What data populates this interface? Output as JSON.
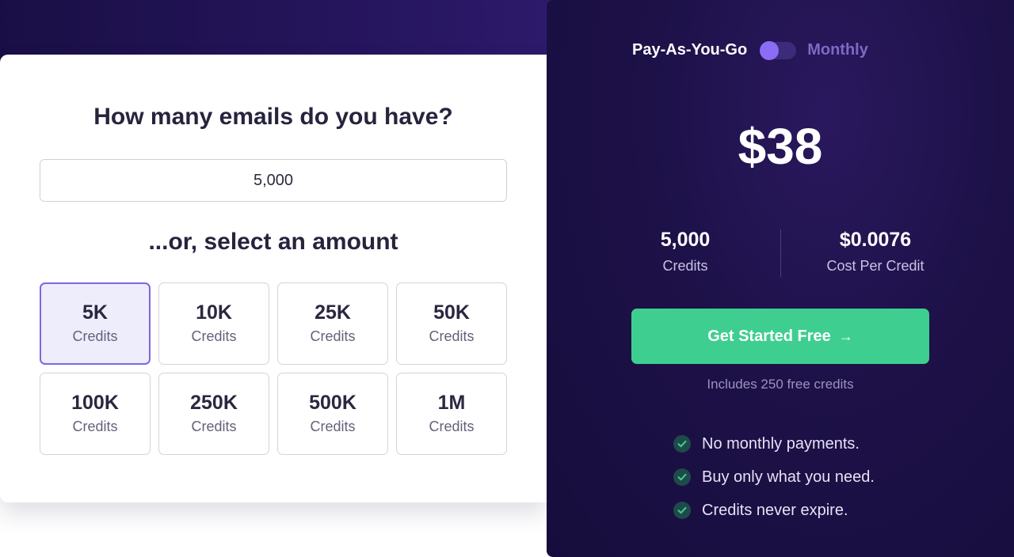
{
  "calculator": {
    "question": "How many emails do you have?",
    "email_count_value": "5,000",
    "select_heading": "...or, select an amount",
    "amounts": [
      {
        "value": "5K",
        "unit": "Credits",
        "selected": true
      },
      {
        "value": "10K",
        "unit": "Credits",
        "selected": false
      },
      {
        "value": "25K",
        "unit": "Credits",
        "selected": false
      },
      {
        "value": "50K",
        "unit": "Credits",
        "selected": false
      },
      {
        "value": "100K",
        "unit": "Credits",
        "selected": false
      },
      {
        "value": "250K",
        "unit": "Credits",
        "selected": false
      },
      {
        "value": "500K",
        "unit": "Credits",
        "selected": false
      },
      {
        "value": "1M",
        "unit": "Credits",
        "selected": false
      }
    ]
  },
  "pricing": {
    "billing_toggle": {
      "left_label": "Pay-As-You-Go",
      "right_label": "Monthly",
      "selected": "Pay-As-You-Go"
    },
    "price": "$38",
    "credits_value": "5,000",
    "credits_label": "Credits",
    "cost_per_credit_value": "$0.0076",
    "cost_per_credit_label": "Cost Per Credit",
    "cta_label": "Get Started Free",
    "cta_icon": "arrow-right-icon",
    "free_note": "Includes 250 free credits",
    "features": [
      "No monthly payments.",
      "Buy only what you need.",
      "Credits never expire."
    ],
    "feature_icon": "check-icon"
  },
  "colors": {
    "accent": "#7c67e0",
    "cta": "#3ecf90",
    "panel_background": "#1d1148"
  }
}
